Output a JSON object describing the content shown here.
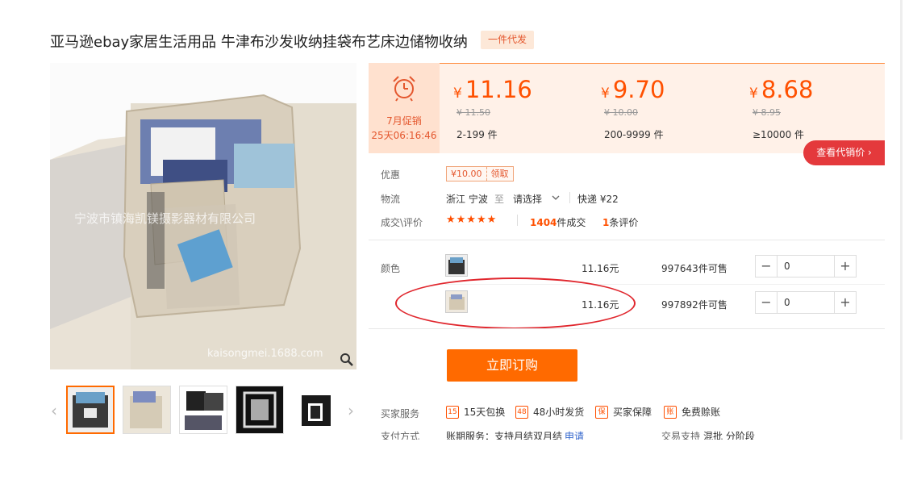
{
  "product": {
    "title": "亚马逊ebay家居生活用品 牛津布沙发收纳挂袋布艺床边储物收纳",
    "tag": "一件代发",
    "watermark": "宁波市镇海凯镁摄影器材有限公司",
    "watermark_url": "kaisongmei.1688.com"
  },
  "promo": {
    "label": "7月促销",
    "countdown": "25天06:16:46"
  },
  "prices": [
    {
      "currency": "¥",
      "price": "11.16",
      "old": "¥ 11.50",
      "range": "2-199 件"
    },
    {
      "currency": "¥",
      "price": "9.70",
      "old": "¥ 10.00",
      "range": "200-9999 件"
    },
    {
      "currency": "¥",
      "price": "8.68",
      "old": "¥ 8.95",
      "range": "≥10000 件"
    }
  ],
  "agent_price_button": "查看代销价 ›",
  "discount": {
    "label": "优惠",
    "amount": "¥10.00",
    "action": "领取"
  },
  "logistics": {
    "label": "物流",
    "from": "浙江 宁波",
    "to_word": "至",
    "to": "请选择",
    "method": "快递 ¥22"
  },
  "deals": {
    "label": "成交\\评价",
    "stars": "★★★★★",
    "count": "1404",
    "count_suffix": "件成交",
    "reviews": "1",
    "reviews_suffix": "条评价"
  },
  "color": {
    "label": "颜色",
    "rows": [
      {
        "price": "11.16元",
        "stock": "997643",
        "stock_suffix": "件可售",
        "qty": "0"
      },
      {
        "price": "11.16元",
        "stock": "997892",
        "stock_suffix": "件可售",
        "qty": "0"
      }
    ],
    "minus": "−",
    "plus": "+"
  },
  "buy_button": "立即订购",
  "services": {
    "label": "买家服务",
    "items": [
      {
        "icon": "15",
        "text": "15天包换"
      },
      {
        "icon": "48",
        "text": "48小时发货"
      },
      {
        "icon": "保",
        "text": "买家保障"
      },
      {
        "icon": "账",
        "text": "免费赊账"
      }
    ]
  },
  "payment": {
    "label": "支付方式",
    "value": "账期服务：支持月结双月结",
    "link": "申请",
    "trade_label": "交易支持",
    "trade_value": "混批   分阶段"
  },
  "icons": {
    "alarm": "alarm-clock-icon",
    "zoom": "magnifier-icon",
    "prev": "chevron-left-icon",
    "next": "chevron-right-icon",
    "dropdown": "chevron-down-icon"
  },
  "colors": {
    "accent": "#ff5000",
    "buy": "#ff6a00",
    "agent": "#e4393c",
    "panel": "#fff1e8",
    "circle": "#e0262d"
  }
}
